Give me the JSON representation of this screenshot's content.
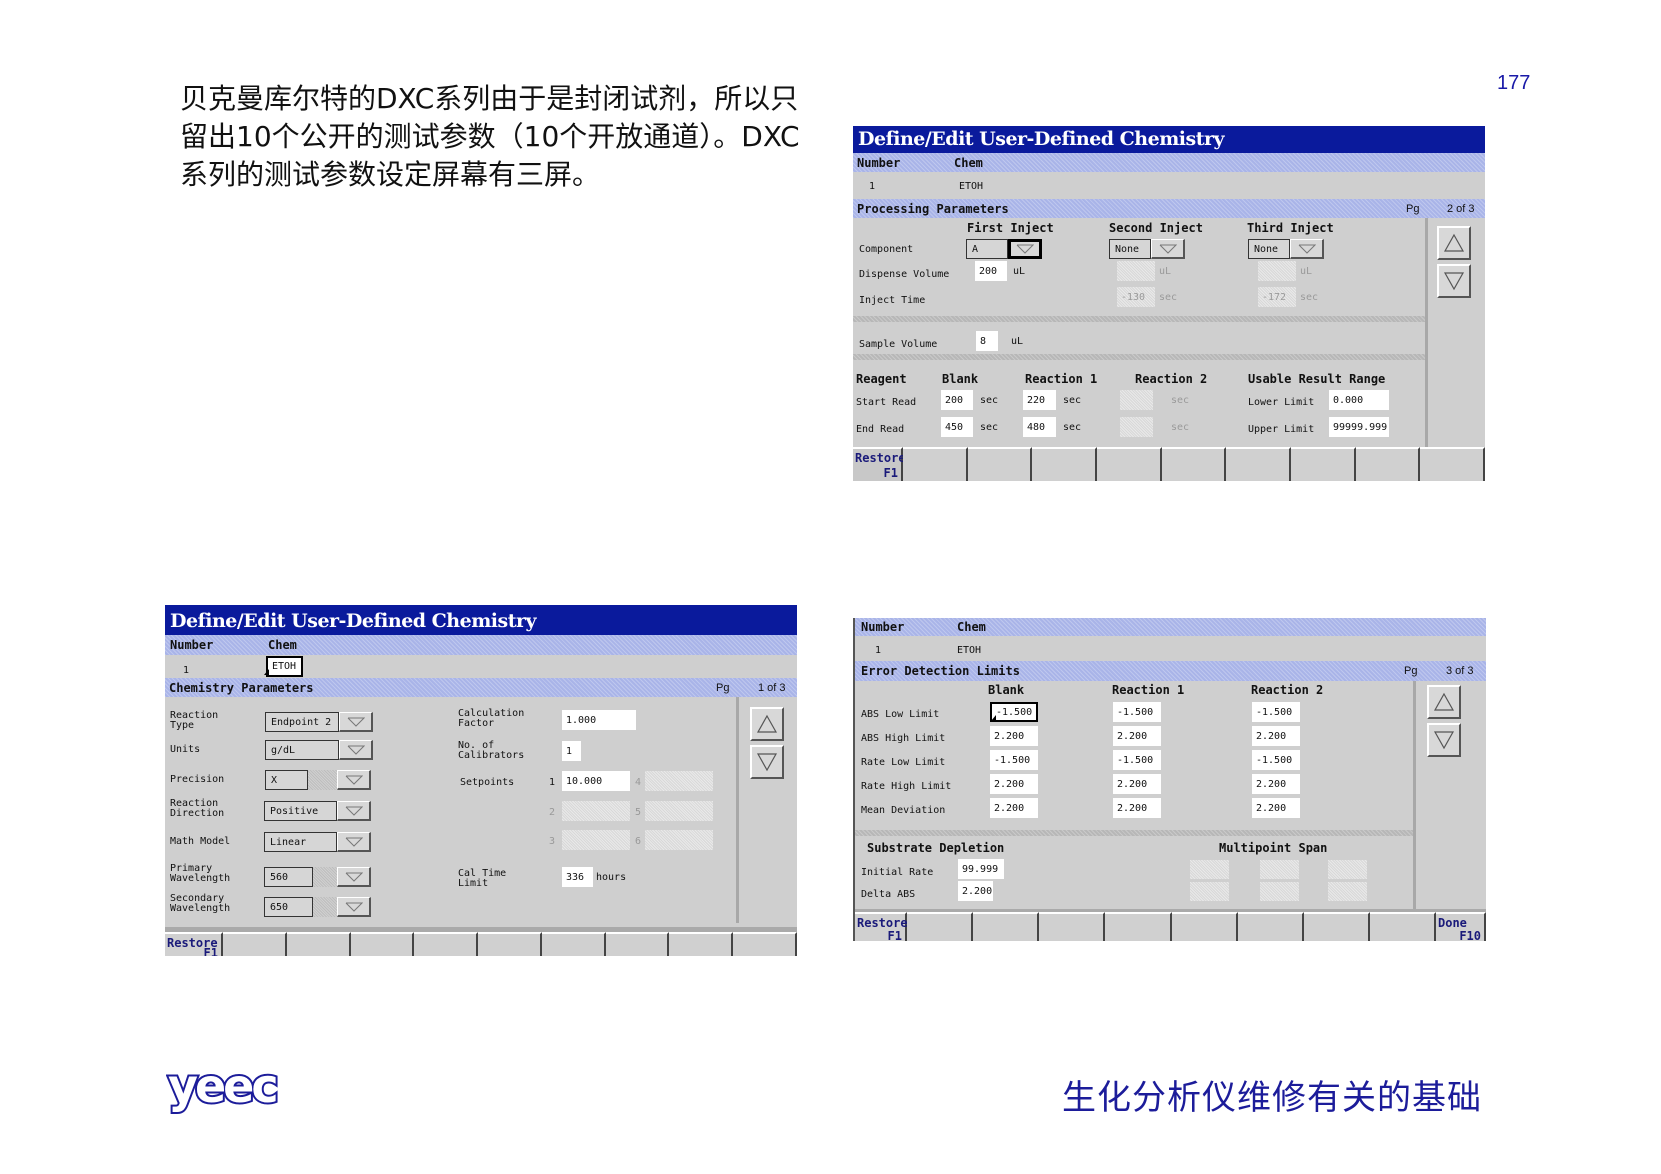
{
  "slide": {
    "intro_text": "贝克曼库尔特的DXC系列由于是封闭试剂，所以只留出10个公开的测试参数（10个开放通道）。DXC 系列的测试参数设定屏幕有三屏。",
    "page_number": "177",
    "footer_title": "生化分析仪维修有关的基础",
    "logo_text": "yeec",
    "brand_color": "#1c1c9a"
  },
  "screen1": {
    "title": "Define/Edit User-Defined Chemistry",
    "number_label": "Number",
    "chem_label": "Chem",
    "number_value": "1",
    "chem_value": "ETOH",
    "section_title": "Chemistry Parameters",
    "pg_label": "Pg",
    "pg_value": "1 of 3",
    "left_fields": [
      {
        "label1": "Reaction",
        "label2": "Type",
        "value": "Endpoint 2"
      },
      {
        "label1": "Units",
        "label2": "",
        "value": "g/dL"
      },
      {
        "label1": "Precision",
        "label2": "",
        "value": "X"
      },
      {
        "label1": "Reaction",
        "label2": "Direction",
        "value": "Positive"
      },
      {
        "label1": "Math Model",
        "label2": "",
        "value": "Linear"
      },
      {
        "label1": "Primary",
        "label2": "Wavelength",
        "value": "560"
      },
      {
        "label1": "Secondary",
        "label2": "Wavelength",
        "value": "650"
      }
    ],
    "calc_factor_label1": "Calculation",
    "calc_factor_label2": "Factor",
    "calc_factor_value": "1.000",
    "calibrators_label1": "No. of",
    "calibrators_label2": "Calibrators",
    "calibrators_value": "1",
    "setpoints_label": "Setpoints",
    "setpoints": [
      {
        "index": "1",
        "value": "10.000"
      },
      {
        "index": "2",
        "value": ""
      },
      {
        "index": "3",
        "value": ""
      },
      {
        "index": "4",
        "value": ""
      },
      {
        "index": "5",
        "value": ""
      },
      {
        "index": "6",
        "value": ""
      }
    ],
    "cal_time_label1": "Cal Time",
    "cal_time_label2": "Limit",
    "cal_time_value": "336",
    "cal_time_unit": "hours",
    "fkeys": [
      {
        "line1": "Restore",
        "line2": "F1"
      }
    ]
  },
  "screen2": {
    "title": "Define/Edit User-Defined Chemistry",
    "number_label": "Number",
    "chem_label": "Chem",
    "number_value": "1",
    "chem_value": "ETOH",
    "section_title": "Processing Parameters",
    "pg_label": "Pg",
    "pg_value": "2 of 3",
    "inject_headers": [
      "First Inject",
      "Second Inject",
      "Third Inject"
    ],
    "component_label": "Component",
    "components": [
      "A",
      "None",
      "None"
    ],
    "dispense_label": "Dispense Volume",
    "dispense_values": [
      "200",
      "",
      ""
    ],
    "dispense_unit": "uL",
    "inject_time_label": "Inject Time",
    "inject_time_values": [
      "",
      "-130",
      "-172"
    ],
    "inject_time_unit": "sec",
    "sample_volume_label": "Sample Volume",
    "sample_volume_value": "8",
    "sample_volume_unit": "uL",
    "read_headers": [
      "Reagent",
      "Blank",
      "Reaction 1",
      "Reaction 2",
      "Usable Result Range"
    ],
    "start_read_label": "Start Read",
    "end_read_label": "End Read",
    "start_read": {
      "blank": "200",
      "reaction1": "220",
      "reaction2": ""
    },
    "end_read": {
      "blank": "450",
      "reaction1": "480",
      "reaction2": ""
    },
    "read_unit": "sec",
    "lower_limit_label": "Lower Limit",
    "lower_limit_value": "0.000",
    "upper_limit_label": "Upper Limit",
    "upper_limit_value": "99999.999",
    "fkeys": [
      {
        "line1": "Restore",
        "line2": "F1"
      }
    ]
  },
  "screen3": {
    "number_label": "Number",
    "chem_label": "Chem",
    "number_value": "1",
    "chem_value": "ETOH",
    "section_title": "Error Detection Limits",
    "pg_label": "Pg",
    "pg_value": "3 of 3",
    "col_headers": [
      "Blank",
      "Reaction 1",
      "Reaction 2"
    ],
    "rows": [
      {
        "label": "ABS Low Limit",
        "values": [
          "-1.500",
          "-1.500",
          "-1.500"
        ]
      },
      {
        "label": "ABS High Limit",
        "values": [
          "2.200",
          "2.200",
          "2.200"
        ]
      },
      {
        "label": "Rate Low Limit",
        "values": [
          "-1.500",
          "-1.500",
          "-1.500"
        ]
      },
      {
        "label": "Rate High Limit",
        "values": [
          "2.200",
          "2.200",
          "2.200"
        ]
      },
      {
        "label": "Mean Deviation",
        "values": [
          "2.200",
          "2.200",
          "2.200"
        ]
      }
    ],
    "substrate_title": "Substrate Depletion",
    "initial_rate_label": "Initial Rate",
    "initial_rate_value": "99.999",
    "delta_abs_label": "Delta ABS",
    "delta_abs_value": "2.200",
    "multipoint_title": "Multipoint Span",
    "fkeys": [
      {
        "line1": "Restore",
        "line2": "F1"
      },
      {
        "line1": "Done",
        "line2": "F10"
      }
    ]
  }
}
